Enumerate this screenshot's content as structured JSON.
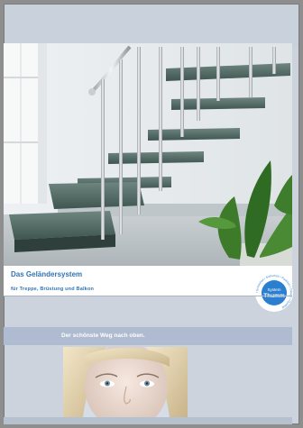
{
  "brochure": {
    "title": "Das Geländersystem",
    "subtitle": "für Treppe, Brüstung und Balkon",
    "tagline": "Der schönste Weg nach oben."
  },
  "badge": {
    "line1": "System",
    "line2": "Thumm",
    "ring_text": "• Schönheit • Sicherheit • Funktion • Design • Qualität "
  },
  "colors": {
    "accent_blue": "#2f74b5",
    "page_blue_grey": "#ccd3dd",
    "badge_blue": "#2a7fd0"
  },
  "images": [
    {
      "name": "staircase-photo"
    },
    {
      "name": "woman-face-photo"
    }
  ]
}
